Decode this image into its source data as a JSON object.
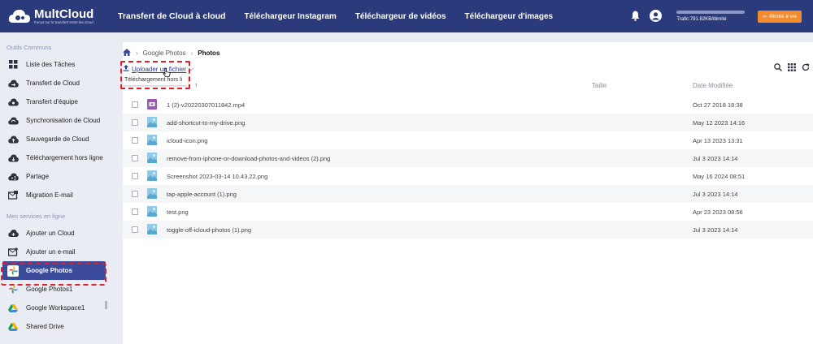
{
  "brand": {
    "name": "MultCloud",
    "tagline": "Focus sur le transfert entre les cloud"
  },
  "nav": {
    "items": [
      {
        "label": "Transfert de Cloud à cloud",
        "active": true
      },
      {
        "label": "Téléchargeur Instagram"
      },
      {
        "label": "Téléchargeur de vidéos"
      },
      {
        "label": "Téléchargeur d'images"
      }
    ]
  },
  "header": {
    "traffic": "Trafic:791.82KB/illimité",
    "upgrade": "Illimité à vie"
  },
  "sidebar": {
    "section1": "Outils Communs",
    "tools": [
      {
        "label": "Liste des Tâches",
        "icon": "grid-icon"
      },
      {
        "label": "Transfert de Cloud",
        "icon": "cloud-transfer-icon"
      },
      {
        "label": "Transfert d'équipe",
        "icon": "team-transfer-icon"
      },
      {
        "label": "Synchronisation de Cloud",
        "icon": "cloud-sync-icon"
      },
      {
        "label": "Sauvegarde de Cloud",
        "icon": "cloud-backup-icon"
      },
      {
        "label": "Téléchargement hors ligne",
        "icon": "cloud-download-icon"
      },
      {
        "label": "Partage",
        "icon": "share-icon"
      },
      {
        "label": "Migration E-mail",
        "icon": "email-migration-icon"
      }
    ],
    "section2": "Mes services en ligne",
    "services": [
      {
        "label": "Ajouter un Cloud",
        "icon": "add-cloud-icon"
      },
      {
        "label": "Ajouter un e-mail",
        "icon": "add-email-icon"
      },
      {
        "label": "Google Photos",
        "icon": "google-photos-icon",
        "active": true
      },
      {
        "label": "Google Photos1",
        "icon": "google-photos-icon"
      },
      {
        "label": "Google Workspace1",
        "icon": "google-drive-icon"
      },
      {
        "label": "Shared Drive",
        "icon": "google-drive-icon"
      }
    ]
  },
  "breadcrumb": {
    "root": "Google Photos",
    "current": "Photos"
  },
  "toolbar": {
    "upload": "Uploader un fichier",
    "dropdown_item": "Téléchargement hors li"
  },
  "table": {
    "columns": {
      "size": "Taille",
      "date": "Date Modifiée"
    },
    "rows": [
      {
        "name": "1 (2)-v20220307011842.mp4",
        "date": "Oct 27 2018 18:38",
        "type": "video"
      },
      {
        "name": "add-shortcut-to-my-drive.png",
        "date": "May 12 2023 14:16",
        "type": "image"
      },
      {
        "name": "icloud-icon.png",
        "date": "Apr 13 2023 13:31",
        "type": "image"
      },
      {
        "name": "remove-from-iphone-or-download-photos-and-videos (2).png",
        "date": "Jul 3 2023 14:14",
        "type": "image"
      },
      {
        "name": "Screenshot 2023-03-14 10.43.22.png",
        "date": "May 16 2024 08:51",
        "type": "image"
      },
      {
        "name": "tap-apple-account (1).png",
        "date": "Jul 3 2023 14:14",
        "type": "image"
      },
      {
        "name": "test.png",
        "date": "Apr 23 2023 08:56",
        "type": "image"
      },
      {
        "name": "toggle-off-icloud-photos (1).png",
        "date": "Jul 3 2023 14:14",
        "type": "image"
      }
    ]
  }
}
